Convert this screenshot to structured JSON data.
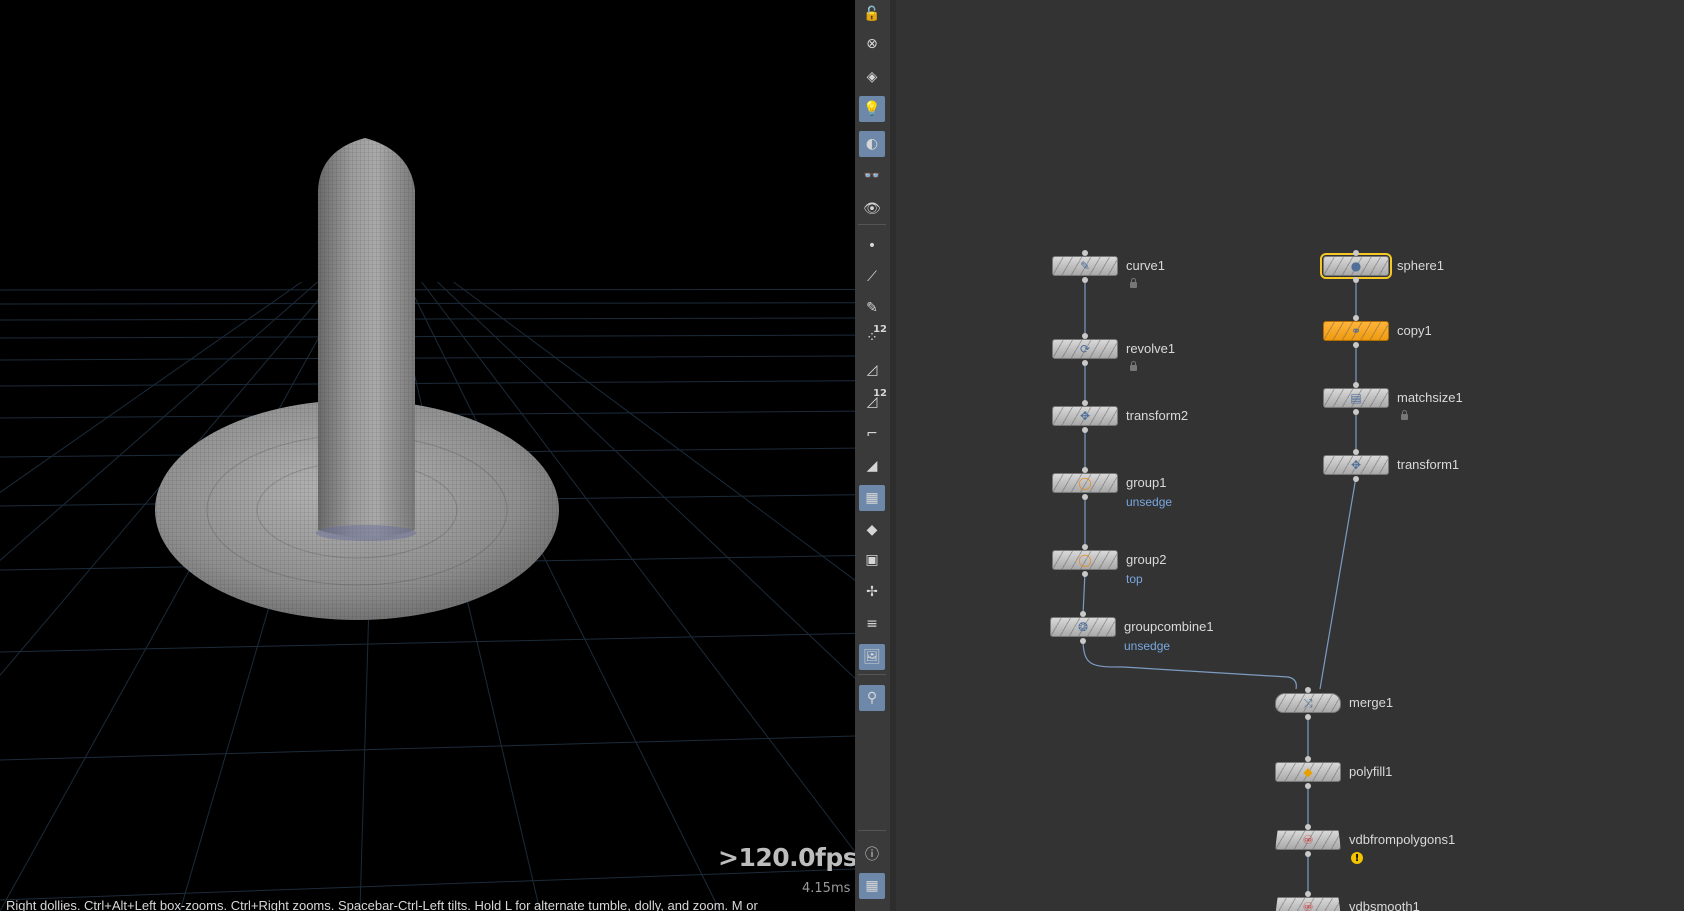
{
  "viewport": {
    "fps": ">120.0fps",
    "frame_time": "4.15ms",
    "hint": "Right dollies. Ctrl+Alt+Left box-zooms. Ctrl+Right zooms. Spacebar-Ctrl-Left tilts. Hold L for alternate tumble, dolly, and zoom. M or"
  },
  "toolbar": {
    "items": [
      {
        "icon": "lock-icon",
        "glyph": "🔓"
      },
      {
        "icon": "close-circle-icon",
        "glyph": "⊗"
      },
      {
        "icon": "light-pin-icon",
        "glyph": "◈"
      },
      {
        "icon": "lightbulb-icon",
        "glyph": "💡"
      },
      {
        "icon": "checker-sphere-icon",
        "glyph": "◐"
      },
      {
        "icon": "eye-glasses-icon",
        "glyph": "👓"
      },
      {
        "icon": "eye-camera-icon",
        "glyph": "👁"
      },
      {
        "icon": "point-icon",
        "glyph": "•"
      },
      {
        "icon": "brush-icon",
        "glyph": "⟋"
      },
      {
        "icon": "pen-icon",
        "glyph": "✎"
      },
      {
        "icon": "point-numbers-icon",
        "glyph": "⁘",
        "num": "12"
      },
      {
        "icon": "prim-display-icon",
        "glyph": "◿"
      },
      {
        "icon": "prim-numbers-icon",
        "glyph": "◿",
        "num": "12"
      },
      {
        "icon": "normals-icon",
        "glyph": "⌐"
      },
      {
        "icon": "wedge-icon",
        "glyph": "◢"
      },
      {
        "icon": "checker-texture-icon",
        "glyph": "▦"
      },
      {
        "icon": "diamond-icon",
        "glyph": "◆"
      },
      {
        "icon": "uv-map-icon",
        "glyph": "▣"
      },
      {
        "icon": "axis-icon",
        "glyph": "✢"
      },
      {
        "icon": "menu-circle-icon",
        "glyph": "≡"
      },
      {
        "icon": "background-image-icon",
        "glyph": "🖼"
      },
      {
        "icon": "location-pin-icon",
        "glyph": "⚲"
      },
      {
        "icon": "info-icon",
        "glyph": "ⓘ"
      },
      {
        "icon": "grid-layout-icon",
        "glyph": "▦"
      }
    ]
  },
  "network": {
    "nodes": [
      {
        "name": "curve1",
        "icon": "curve-icon",
        "glyph": "✎",
        "locked": true
      },
      {
        "name": "revolve1",
        "icon": "revolve-icon",
        "glyph": "⟳",
        "locked": true
      },
      {
        "name": "transform2",
        "icon": "transform-icon",
        "glyph": "✥"
      },
      {
        "name": "group1",
        "icon": "group-icon",
        "glyph": "◯",
        "sub": "unsedge"
      },
      {
        "name": "group2",
        "icon": "group-icon",
        "glyph": "◯",
        "sub": "top"
      },
      {
        "name": "groupcombine1",
        "icon": "groupcombine-icon",
        "glyph": "❂",
        "sub": "unsedge"
      },
      {
        "name": "sphere1",
        "icon": "sphere-icon",
        "glyph": "●",
        "selected": true
      },
      {
        "name": "copy1",
        "icon": "copy-icon",
        "glyph": "⚭",
        "render_flag": true
      },
      {
        "name": "matchsize1",
        "icon": "matchsize-icon",
        "glyph": "▤",
        "locked": true
      },
      {
        "name": "transform1",
        "icon": "transform-icon",
        "glyph": "✥"
      },
      {
        "name": "merge1",
        "icon": "merge-icon",
        "glyph": "⤨"
      },
      {
        "name": "polyfill1",
        "icon": "polyfill-icon",
        "glyph": "◆"
      },
      {
        "name": "vdbfrompolygons1",
        "icon": "vdb-icon",
        "glyph": "♾",
        "warning": "!"
      },
      {
        "name": "vdbsmooth1",
        "icon": "vdb-icon",
        "glyph": "♾"
      }
    ]
  }
}
